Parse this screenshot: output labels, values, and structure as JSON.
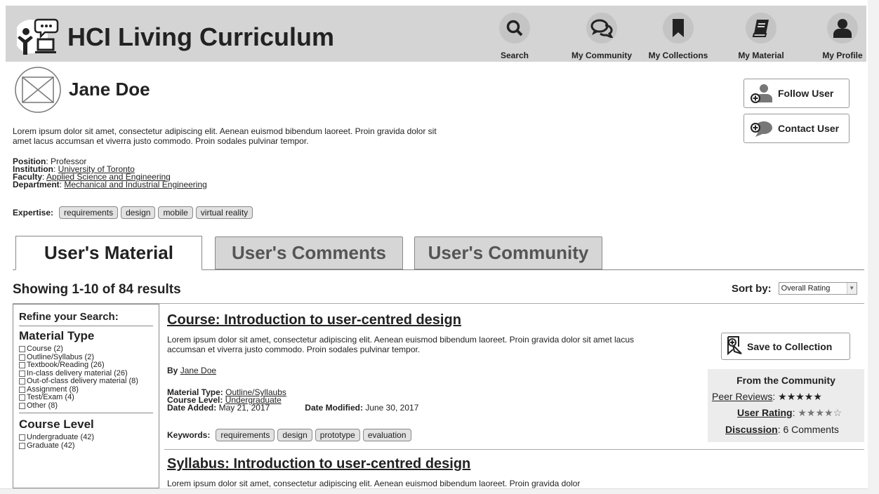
{
  "header": {
    "app_title": "HCI Living Curriculum",
    "nav": [
      {
        "label": "Search",
        "icon": "search-icon"
      },
      {
        "label": "My Community",
        "icon": "chat-bubbles-icon"
      },
      {
        "label": "My Collections",
        "icon": "bookmark-icon"
      },
      {
        "label": "My Material",
        "icon": "book-icon"
      },
      {
        "label": "My Profile",
        "icon": "person-icon"
      }
    ]
  },
  "profile": {
    "name": "Jane Doe",
    "bio": "Lorem ipsum dolor sit amet, consectetur adipiscing elit. Aenean euismod bibendum laoreet. Proin gravida dolor sit amet lacus accumsan et viverra justo commodo. Proin sodales pulvinar tempor.",
    "position_label": "Position",
    "position": "Professor",
    "institution_label": "Institution",
    "institution": "University of Toronto",
    "faculty_label": "Faculty",
    "faculty": "Applied Science and Engineering",
    "department_label": "Department",
    "department": "Mechanical and Industrial Engineering",
    "expertise_label": "Expertise:",
    "expertise": [
      "requirements",
      "design",
      "mobile",
      "virtual reality"
    ],
    "follow_label": "Follow User",
    "contact_label": "Contact User"
  },
  "tabs": [
    "User's Material",
    "User's Comments",
    "User's Community"
  ],
  "results": {
    "count_text": "Showing 1-10 of 84 results",
    "sort_label": "Sort by:",
    "sort_value": "Overall Rating"
  },
  "refine": {
    "title": "Refine your Search:",
    "material_type_heading": "Material Type",
    "material_types": [
      "Course (2)",
      "Outline/Syllabus (2)",
      "Textbook/Reading (26)",
      "In-class delivery material (26)",
      "Out-of-class delivery material (8)",
      "Assignment (8)",
      "Test/Exam (4)",
      "Other (8)"
    ],
    "course_level_heading": "Course Level",
    "course_levels": [
      "Undergraduate (42)",
      "Graduate (42)"
    ]
  },
  "items": [
    {
      "title": "Course: Introduction to user-centred design",
      "desc": "Lorem ipsum dolor sit amet, consectetur adipiscing elit. Aenean euismod bibendum laoreet. Proin gravida dolor sit amet lacus accumsan et viverra justo commodo. Proin sodales pulvinar tempor.",
      "by_label": "By",
      "author": "Jane Doe",
      "material_type_label": "Material Type:",
      "material_type": "Outline/Syllaubs",
      "course_level_label": "Course Level:",
      "course_level": "Undergraduate",
      "date_added_label": "Date Added:",
      "date_added": "May 21, 2017",
      "date_modified_label": "Date Modified:",
      "date_modified": "June 30, 2017",
      "keywords_label": "Keywords:",
      "keywords": [
        "requirements",
        "design",
        "prototype",
        "evaluation"
      ],
      "save_label": "Save to Collection",
      "community_title": "From the Community",
      "peer_reviews_label": "Peer Reviews",
      "peer_reviews_stars": 5,
      "user_rating_label": "User Rating",
      "user_rating_stars": 4.5,
      "discussion_label": "Discussion",
      "discussion_value": "6 Comments"
    },
    {
      "title": "Syllabus: Introduction to user-centred design",
      "desc": "Lorem ipsum dolor sit amet, consectetur adipiscing elit. Aenean euismod bibendum laoreet. Proin gravida dolor"
    }
  ]
}
